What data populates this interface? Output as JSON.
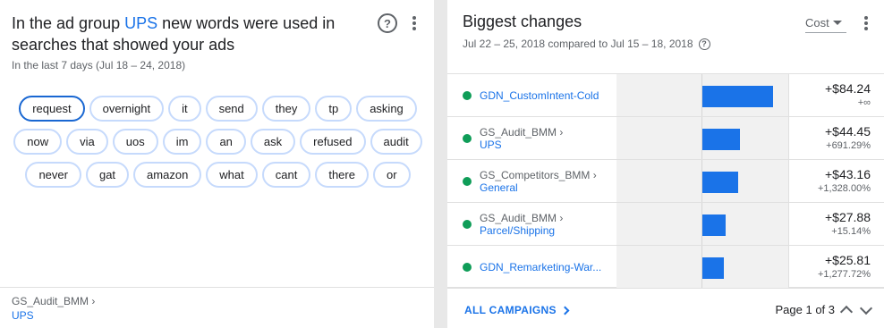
{
  "left": {
    "title_prefix": "In the ad group ",
    "title_keyword": "UPS",
    "title_suffix": " new words were used in searches that showed your ads",
    "subtitle": "In the last 7 days (Jul 18 – 24, 2018)",
    "chips": [
      [
        "request",
        "overnight",
        "it",
        "send",
        "they",
        "tp",
        "asking"
      ],
      [
        "now",
        "via",
        "uos",
        "im",
        "an",
        "ask",
        "refused",
        "audit"
      ],
      [
        "never",
        "gat",
        "amazon",
        "what",
        "cant",
        "there",
        "or"
      ]
    ],
    "footer_parent": "GS_Audit_BMM ›",
    "footer_child": "UPS"
  },
  "right": {
    "title": "Biggest changes",
    "subtitle": "Jul 22 – 25, 2018 compared to Jul 15 – 18, 2018",
    "metric": "Cost",
    "rows": [
      {
        "parent": "",
        "name": "GDN_CustomIntent-Cold",
        "value": "+$84.24",
        "change": "+∞",
        "amount": 84.24
      },
      {
        "parent": "GS_Audit_BMM ›",
        "name": "UPS",
        "value": "+$44.45",
        "change": "+691.29%",
        "amount": 44.45
      },
      {
        "parent": "GS_Competitors_BMM ›",
        "name": "General",
        "value": "+$43.16",
        "change": "+1,328.00%",
        "amount": 43.16
      },
      {
        "parent": "GS_Audit_BMM ›",
        "name": "Parcel/Shipping",
        "value": "+$27.88",
        "change": "+15.14%",
        "amount": 27.88
      },
      {
        "parent": "",
        "name": "GDN_Remarketing-War...",
        "value": "+$25.81",
        "change": "+1,277.72%",
        "amount": 25.81
      }
    ],
    "all_link": "ALL CAMPAIGNS",
    "pager": "Page 1 of 3"
  },
  "colors": {
    "accent": "#1a73e8",
    "status_dot": "#0f9d58",
    "chip_border": "#c6dafc"
  }
}
